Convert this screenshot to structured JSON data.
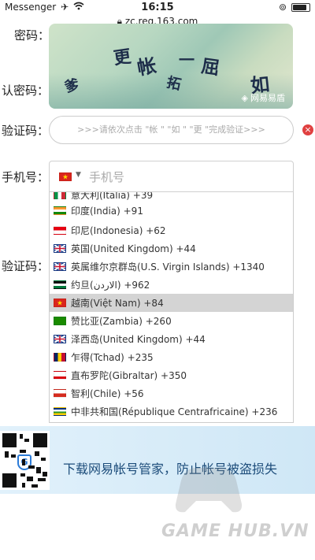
{
  "status_bar": {
    "back_app": "Messenger",
    "time": "16:15",
    "battery_level": 0.85
  },
  "url_bar": {
    "host": "zc.reg.163.com"
  },
  "form": {
    "password_label": "密码：",
    "confirm_password_label": "认密码：",
    "captcha_label": "验证码：",
    "phone_label": "手机号：",
    "phone_placeholder": "手机号",
    "sms_code_label": "验证码："
  },
  "captcha": {
    "chars": [
      "更",
      "帐",
      "一",
      "屈",
      "爹",
      "拓",
      "如"
    ],
    "brand": "网易易盾",
    "prompt": ">>>请依次点击 \"帐 \" \"如 \" \"更 \"完成验证>>>"
  },
  "country_dropdown": {
    "options": [
      {
        "label": "意大利(Italia) +39",
        "flag": "italy"
      },
      {
        "label": "印度(India) +91",
        "flag": "india"
      },
      {
        "label": "印尼(Indonesia) +62",
        "flag": "indonesia"
      },
      {
        "label": "英国(United Kingdom) +44",
        "flag": "uk"
      },
      {
        "label": "英属维尔京群岛(U.S. Virgin Islands) +1340",
        "flag": "bvi"
      },
      {
        "label": "约旦(الاردن) +962",
        "flag": "jordan"
      },
      {
        "label": "越南(Việt Nam) +84",
        "flag": "vietnam",
        "selected": true
      },
      {
        "label": "赞比亚(Zambia) +260",
        "flag": "zambia"
      },
      {
        "label": "泽西岛(United Kingdom) +44",
        "flag": "uk"
      },
      {
        "label": "乍得(Tchad) +235",
        "flag": "chad"
      },
      {
        "label": "直布罗陀(Gibraltar) +350",
        "flag": "gibraltar"
      },
      {
        "label": "智利(Chile) +56",
        "flag": "chile"
      },
      {
        "label": "中非共和国(République Centrafricaine) +236",
        "flag": "car"
      }
    ]
  },
  "banner": {
    "text": "下载网易帐号管家，防止帐号被盗损失"
  },
  "watermark": {
    "text": "GAME HUB.VN"
  },
  "colors": {
    "accent": "#2b7bd8",
    "error": "#e04040",
    "selected_row": "#d4d4d4"
  }
}
